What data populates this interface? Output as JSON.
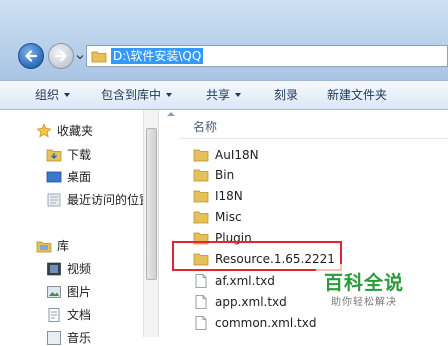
{
  "address": {
    "path": "D:\\软件安装\\QQ"
  },
  "toolbar": {
    "organize": "组织",
    "include": "包含到库中",
    "share": "共享",
    "burn": "刻录",
    "new_folder": "新建文件夹"
  },
  "nav": {
    "favorites": "收藏夹",
    "downloads": "下载",
    "desktop": "桌面",
    "recent": "最近访问的位置",
    "libraries": "库",
    "videos": "视频",
    "pictures": "图片",
    "documents": "文档",
    "music": "音乐"
  },
  "content": {
    "column_name": "名称",
    "items": [
      {
        "name": "AuI18N",
        "type": "folder"
      },
      {
        "name": "Bin",
        "type": "folder"
      },
      {
        "name": "I18N",
        "type": "folder"
      },
      {
        "name": "Misc",
        "type": "folder"
      },
      {
        "name": "Plugin",
        "type": "folder"
      },
      {
        "name": "Resource.1.65.2221",
        "type": "folder"
      },
      {
        "name": "af.xml.txd",
        "type": "file"
      },
      {
        "name": "app.xml.txd",
        "type": "file"
      },
      {
        "name": "common.xml.txd",
        "type": "file"
      }
    ]
  },
  "watermark": {
    "title": "百科全说",
    "subtitle": "助你轻松解决"
  },
  "colors": {
    "highlight": "#e3252e",
    "selection": "#3399ff",
    "watermark": "#2a9a3b"
  }
}
